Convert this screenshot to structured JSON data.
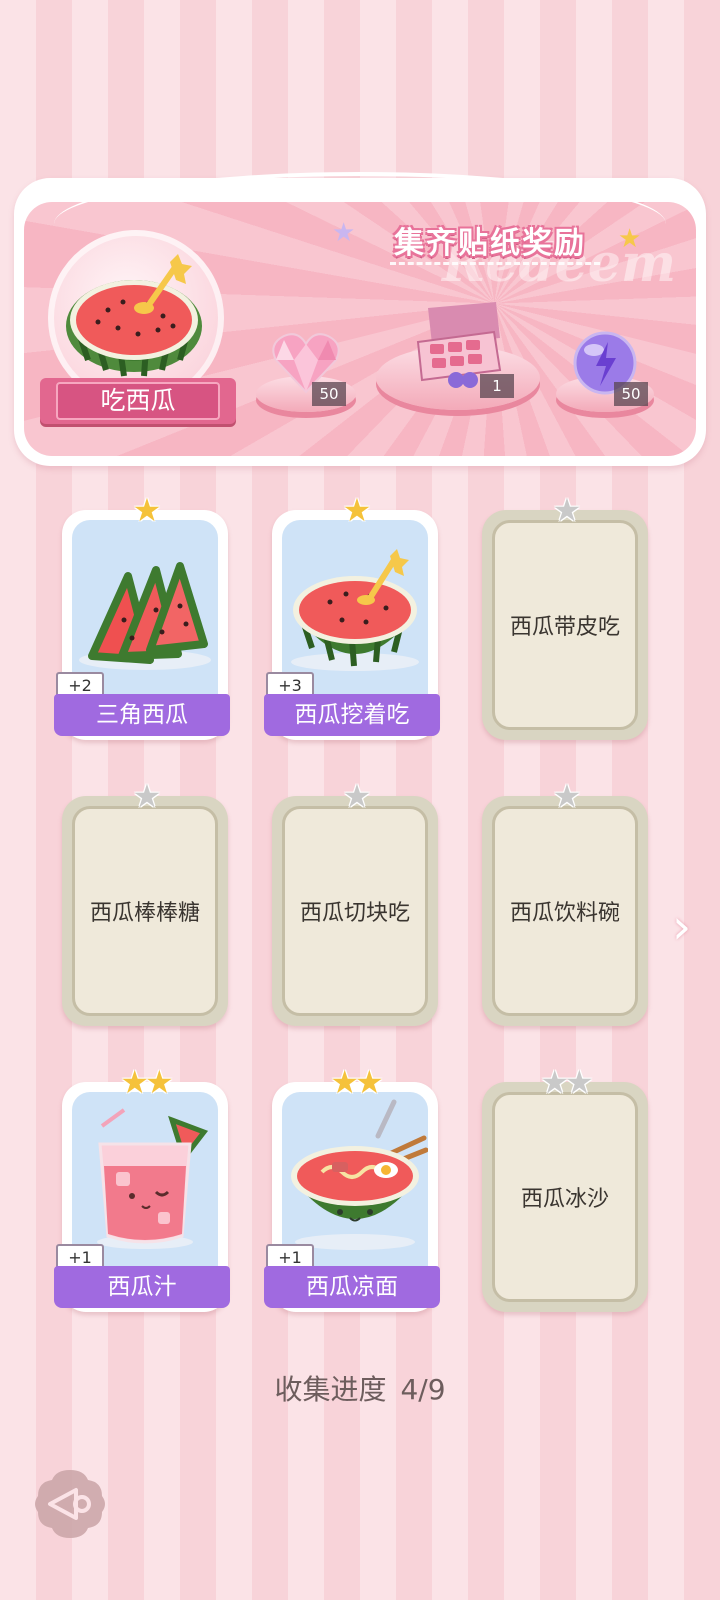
{
  "banner": {
    "title": "集齐贴纸奖励",
    "watermark": "Redeem",
    "main_item_label": "吃西瓜",
    "rewards": [
      {
        "icon": "pink-heart-gem-icon",
        "count": "50"
      },
      {
        "icon": "gift-box-icon",
        "count": "1"
      },
      {
        "icon": "purple-energy-orb-icon",
        "count": "50"
      }
    ]
  },
  "cards": [
    {
      "name": "三角西瓜",
      "stars": 1,
      "unlocked": true,
      "bonus": "+2",
      "art": "watermelon-slices"
    },
    {
      "name": "西瓜挖着吃",
      "stars": 1,
      "unlocked": true,
      "bonus": "+3",
      "art": "watermelon-half-spoon"
    },
    {
      "name": "西瓜带皮吃",
      "stars": 1,
      "unlocked": false
    },
    {
      "name": "西瓜棒棒糖",
      "stars": 1,
      "unlocked": false
    },
    {
      "name": "西瓜切块吃",
      "stars": 1,
      "unlocked": false
    },
    {
      "name": "西瓜饮料碗",
      "stars": 1,
      "unlocked": false
    },
    {
      "name": "西瓜汁",
      "stars": 2,
      "unlocked": true,
      "bonus": "+1",
      "art": "watermelon-juice"
    },
    {
      "name": "西瓜凉面",
      "stars": 2,
      "unlocked": true,
      "bonus": "+1",
      "art": "watermelon-noodles"
    },
    {
      "name": "西瓜冰沙",
      "stars": 2,
      "unlocked": false
    }
  ],
  "progress": {
    "label": "收集进度",
    "value": "4/9"
  },
  "nav": {
    "next": "chevron-right-icon",
    "back": "back-icon"
  },
  "colors": {
    "accent_pink": "#e2678f",
    "name_band": "#a06ae0",
    "gold_star": "#f5c23a",
    "locked_card": "#efe9da"
  }
}
